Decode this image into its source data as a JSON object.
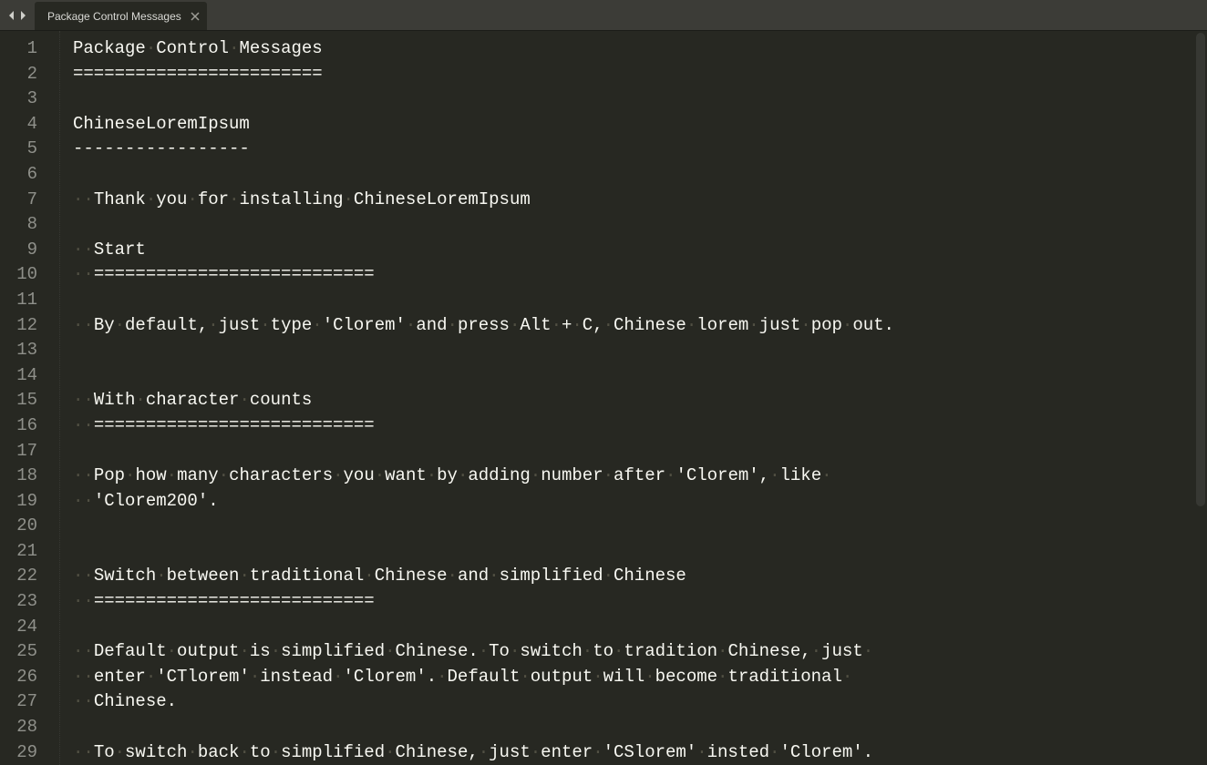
{
  "tabbar": {
    "tab_title": "Package Control Messages"
  },
  "gutter": {
    "count": 29
  },
  "lines": [
    {
      "indent": 0,
      "text": "Package Control Messages"
    },
    {
      "indent": 0,
      "text": "========================"
    },
    {
      "indent": 0,
      "text": ""
    },
    {
      "indent": 0,
      "text": "ChineseLoremIpsum"
    },
    {
      "indent": 0,
      "text": "-----------------"
    },
    {
      "indent": 0,
      "text": ""
    },
    {
      "indent": 2,
      "text": "Thank you for installing ChineseLoremIpsum"
    },
    {
      "indent": 0,
      "text": ""
    },
    {
      "indent": 2,
      "text": "Start"
    },
    {
      "indent": 2,
      "text": "==========================="
    },
    {
      "indent": 0,
      "text": ""
    },
    {
      "indent": 2,
      "text": "By default, just type 'Clorem' and press Alt + C, Chinese lorem just pop out."
    },
    {
      "indent": 0,
      "text": ""
    },
    {
      "indent": 0,
      "text": ""
    },
    {
      "indent": 2,
      "text": "With character counts"
    },
    {
      "indent": 2,
      "text": "==========================="
    },
    {
      "indent": 0,
      "text": ""
    },
    {
      "indent": 2,
      "text": "Pop how many characters you want by adding number after 'Clorem', like "
    },
    {
      "indent": 2,
      "text": "'Clorem200'."
    },
    {
      "indent": 0,
      "text": ""
    },
    {
      "indent": 0,
      "text": ""
    },
    {
      "indent": 2,
      "text": "Switch between traditional Chinese and simplified Chinese"
    },
    {
      "indent": 2,
      "text": "==========================="
    },
    {
      "indent": 0,
      "text": ""
    },
    {
      "indent": 2,
      "text": "Default output is simplified Chinese. To switch to tradition Chinese, just "
    },
    {
      "indent": 2,
      "text": "enter 'CTlorem' instead 'Clorem'. Default output will become traditional "
    },
    {
      "indent": 2,
      "text": "Chinese."
    },
    {
      "indent": 0,
      "text": ""
    },
    {
      "indent": 2,
      "text": "To switch back to simplified Chinese, just enter 'CSlorem' insted 'Clorem'."
    }
  ]
}
